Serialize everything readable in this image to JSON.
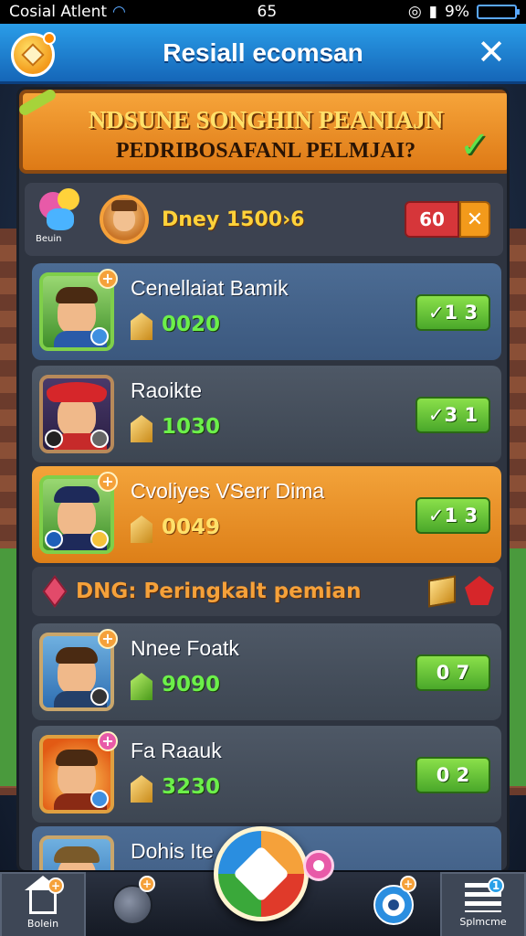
{
  "status_bar": {
    "carrier": "Cosial Atlent",
    "time": "65",
    "battery_percent": "9%"
  },
  "header": {
    "title": "Resiall ecomsan"
  },
  "banner": {
    "line1": "NDSUNE SONGHIN PEANIAJN",
    "line2": "PEDRIBOSAFANL PELMJAI?"
  },
  "my_rank": {
    "logo_label": "Beuin",
    "label": "Dney 1500›6",
    "score": "60",
    "score_icon": "x-icon"
  },
  "players_top": [
    {
      "name": "Cenellaiat Bamik",
      "score": "0020",
      "button": "✓1 3",
      "style": "blue"
    },
    {
      "name": "Raoikte",
      "score": "1030",
      "button": "✓3 1",
      "style": "gray"
    },
    {
      "name": "Cvoliyes VSerr Dima",
      "score": "0049",
      "button": "✓1 3",
      "style": "orange"
    }
  ],
  "section": {
    "label": "DNG: Peringkalt pemian"
  },
  "players_bottom": [
    {
      "name": "Nnee Foatk",
      "score": "9090",
      "button": "0 7",
      "style": "gray"
    },
    {
      "name": "Fa Raauk",
      "score": "3230",
      "button": "0 2",
      "style": "gray"
    },
    {
      "name": "Dohis Ite",
      "score": "",
      "button": "",
      "style": "blue"
    }
  ],
  "bottom_nav": {
    "home_label": "Bolein",
    "settings_label": "Splmcme"
  },
  "colors": {
    "header_blue": "#1f85d6",
    "accent_orange": "#f39a1b",
    "score_green": "#6cf04a",
    "button_green": "#5ab832"
  }
}
